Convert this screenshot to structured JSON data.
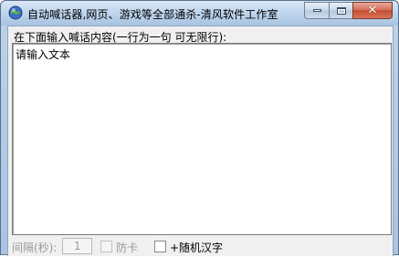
{
  "window": {
    "title": "自动喊话器,网页、游戏等全部通杀-清风软件工作室",
    "icon": "app-globe-icon",
    "buttons": {
      "minimize": "minimize-icon",
      "maximize": "maximize-icon",
      "close": "close-icon"
    }
  },
  "main": {
    "prompt": "在下面输入喊话内容(一行为一句 可无限行):",
    "textarea_value": "请输入文本"
  },
  "bottom": {
    "interval_label": "间隔(秒):",
    "interval_value": "1",
    "anti_stuck_label": "防卡",
    "anti_stuck_checked": false,
    "anti_stuck_enabled": false,
    "random_chinese_label": "+随机汉字",
    "random_chinese_checked": false
  },
  "colors": {
    "close_button": "#c44d31",
    "titlebar": "#bcd3ec",
    "client_bg": "#f0f0f0",
    "disabled_text": "#9a9a9a"
  }
}
